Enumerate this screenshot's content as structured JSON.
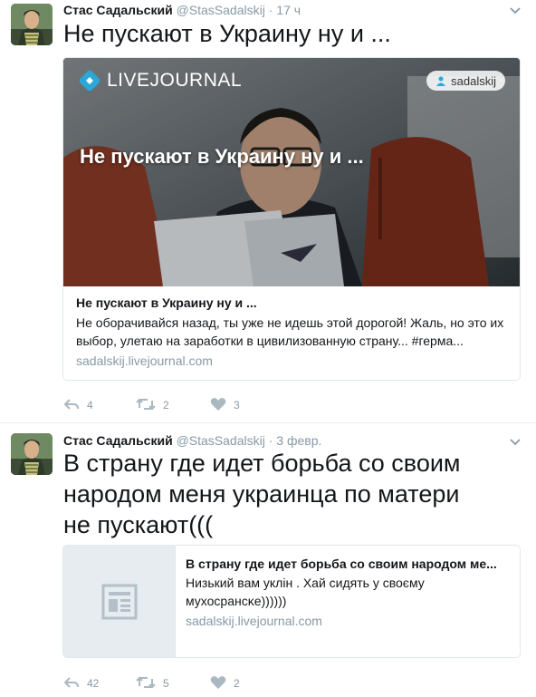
{
  "tweets": [
    {
      "author_name": "Стас Садальский",
      "handle": "@StasSadalskij",
      "separator": "·",
      "time": "17 ч",
      "text": "Не пускают в Украину ну и ...",
      "card": {
        "brand": "LIVEJOURNAL",
        "user_badge": "sadalskij",
        "image_caption": "Не пускают в Украину ну и ...",
        "title": "Не пускают в Украину ну и ...",
        "description": "Не оборачивайся назад, ты уже не идешь этой дорогой! Жаль, но это их выбор, улетаю на заработки в цивилизованную страну... #герма...",
        "domain": "sadalskij.livejournal.com"
      },
      "actions": {
        "reply_icon": "reply-icon",
        "reply_count": "4",
        "retweet_icon": "retweet-icon",
        "retweet_count": "2",
        "like_icon": "heart-icon",
        "like_count": "3"
      }
    },
    {
      "author_name": "Стас Садальский",
      "handle": "@StasSadalskij",
      "separator": "·",
      "time": "3 февр.",
      "text": "В страну где идет борьба со своим народом меня украинца по матери не пускают(((",
      "card": {
        "thumbnail_icon": "article-icon",
        "title": "В страну где идет борьба со своим народом ме...",
        "description": "Низький вам уклін . Хай сидять у своєму мухосрансĸе))))))",
        "domain": "sadalskij.livejournal.com"
      },
      "actions": {
        "reply_icon": "reply-icon",
        "reply_count": "42",
        "retweet_icon": "retweet-icon",
        "retweet_count": "5",
        "like_icon": "heart-icon",
        "like_count": "2"
      }
    }
  ],
  "colors": {
    "secondary_text": "#8899a6",
    "border": "#e1e8ed",
    "primary_text": "#14171a"
  }
}
